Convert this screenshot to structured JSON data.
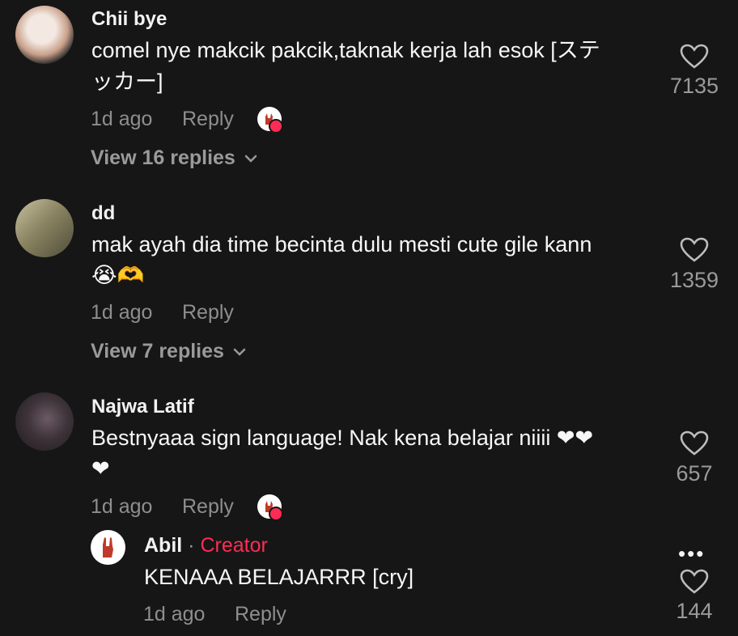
{
  "comments": [
    {
      "username": "Chii bye",
      "text_line1": "comel nye makcik pakcik,taknak kerja lah esok [ステ",
      "text_line2": "ッカー]",
      "time": "1d ago",
      "reply_label": "Reply",
      "view_replies": "View 16 replies",
      "likes": "7135"
    },
    {
      "username": "dd",
      "text_line1": "mak ayah dia time becinta dulu mesti cute gile kann",
      "text_line2": "😭🫶",
      "time": "1d ago",
      "reply_label": "Reply",
      "view_replies": "View 7 replies",
      "likes": "1359"
    },
    {
      "username": "Najwa Latif",
      "text_line1": "Bestnyaaa sign language! Nak kena belajar niiii ❤❤",
      "text_line2": "❤",
      "time": "1d ago",
      "reply_label": "Reply",
      "likes": "657"
    }
  ],
  "reply": {
    "username": "Abil",
    "separator": " · ",
    "badge": "Creator",
    "text": "KENAAA BELAJARRR [cry]",
    "time": "1d ago",
    "reply_label": "Reply",
    "likes": "144",
    "more": "•••"
  },
  "colors": {
    "accent": "#fe2c55",
    "muted": "#8e8e8e",
    "background": "#161616"
  },
  "icons": [
    "heart-outline-icon",
    "chevron-down-icon",
    "creator-liked-badge-icon",
    "more-options-icon"
  ]
}
